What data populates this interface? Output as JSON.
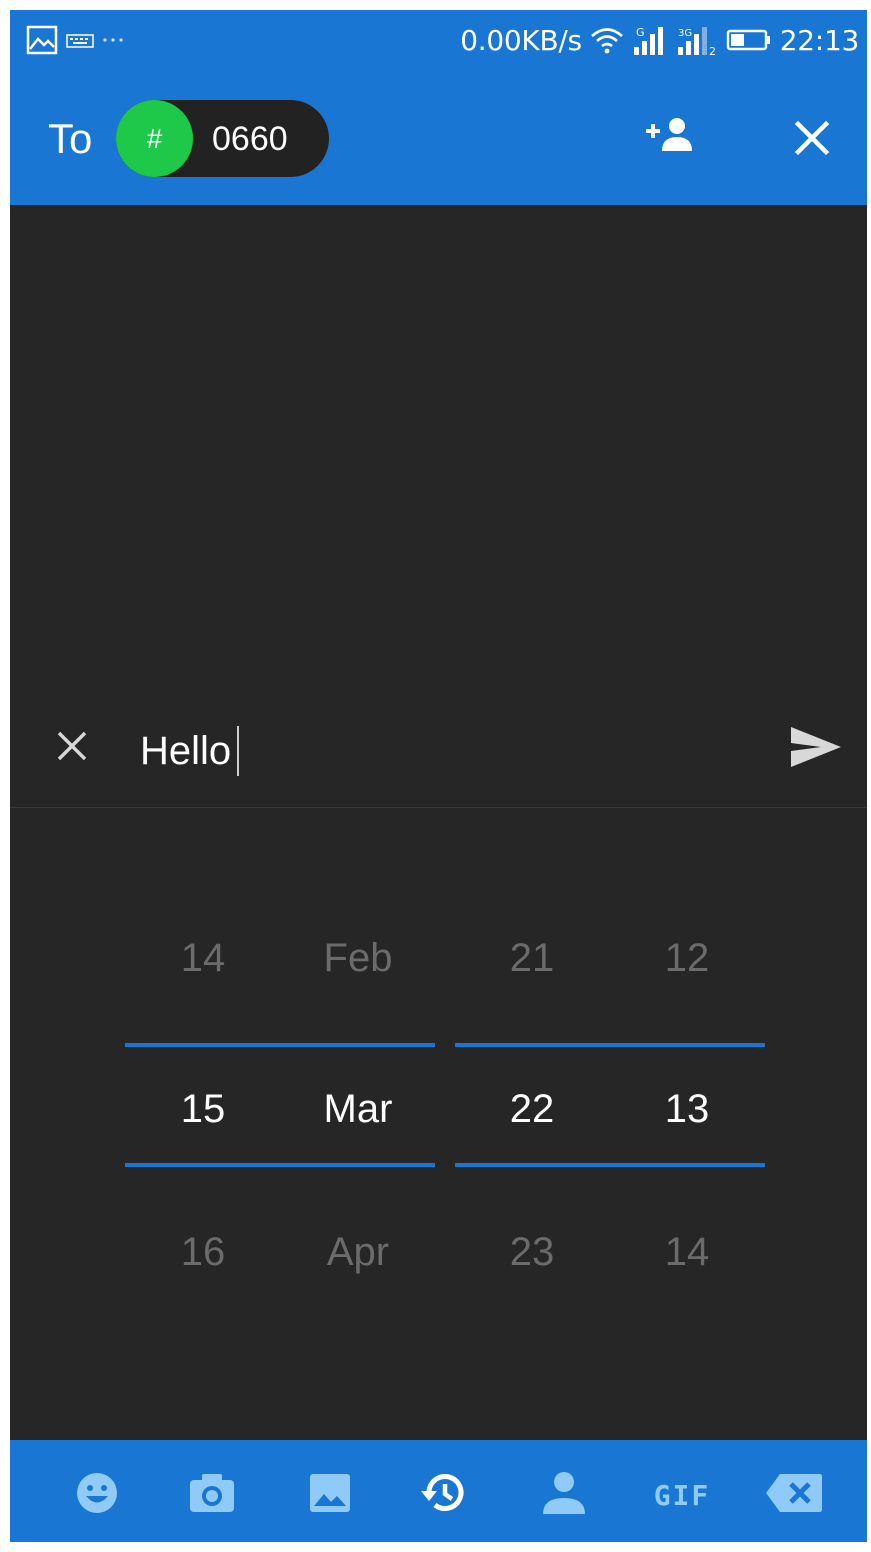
{
  "status_bar": {
    "speed": "0.00KB/s",
    "sim1_label": "G",
    "sim2_label": "3G",
    "sim2_sub": "2",
    "time": "22:13",
    "icons": [
      "image-notification-icon",
      "keyboard-notification-icon",
      "more-notifications-icon",
      "wifi-icon",
      "signal-sim1-icon",
      "signal-sim2-icon",
      "battery-icon"
    ]
  },
  "app_bar": {
    "to_label": "To",
    "recipient": {
      "avatar_text": "#",
      "name": "0660"
    },
    "add_contact_icon": "person-add-icon",
    "close_icon": "close-icon"
  },
  "compose": {
    "message": "Hello",
    "clear_icon": "close-icon",
    "send_icon": "send-icon"
  },
  "picker": {
    "day": [
      "14",
      "15",
      "16"
    ],
    "month": [
      "Feb",
      "Mar",
      "Apr"
    ],
    "hour": [
      "21",
      "22",
      "23"
    ],
    "minute": [
      "12",
      "13",
      "14"
    ],
    "selected_index": 1
  },
  "toolbar": {
    "gif_label": "GIF",
    "icons": [
      "emoji-icon",
      "camera-icon",
      "gallery-icon",
      "schedule-icon",
      "contact-icon",
      "gif-icon",
      "backspace-icon"
    ]
  },
  "colors": {
    "primary": "#1976d2",
    "background": "#262626",
    "chip_avatar": "#1ec94a",
    "toolbar_icon": "#90caf9"
  }
}
